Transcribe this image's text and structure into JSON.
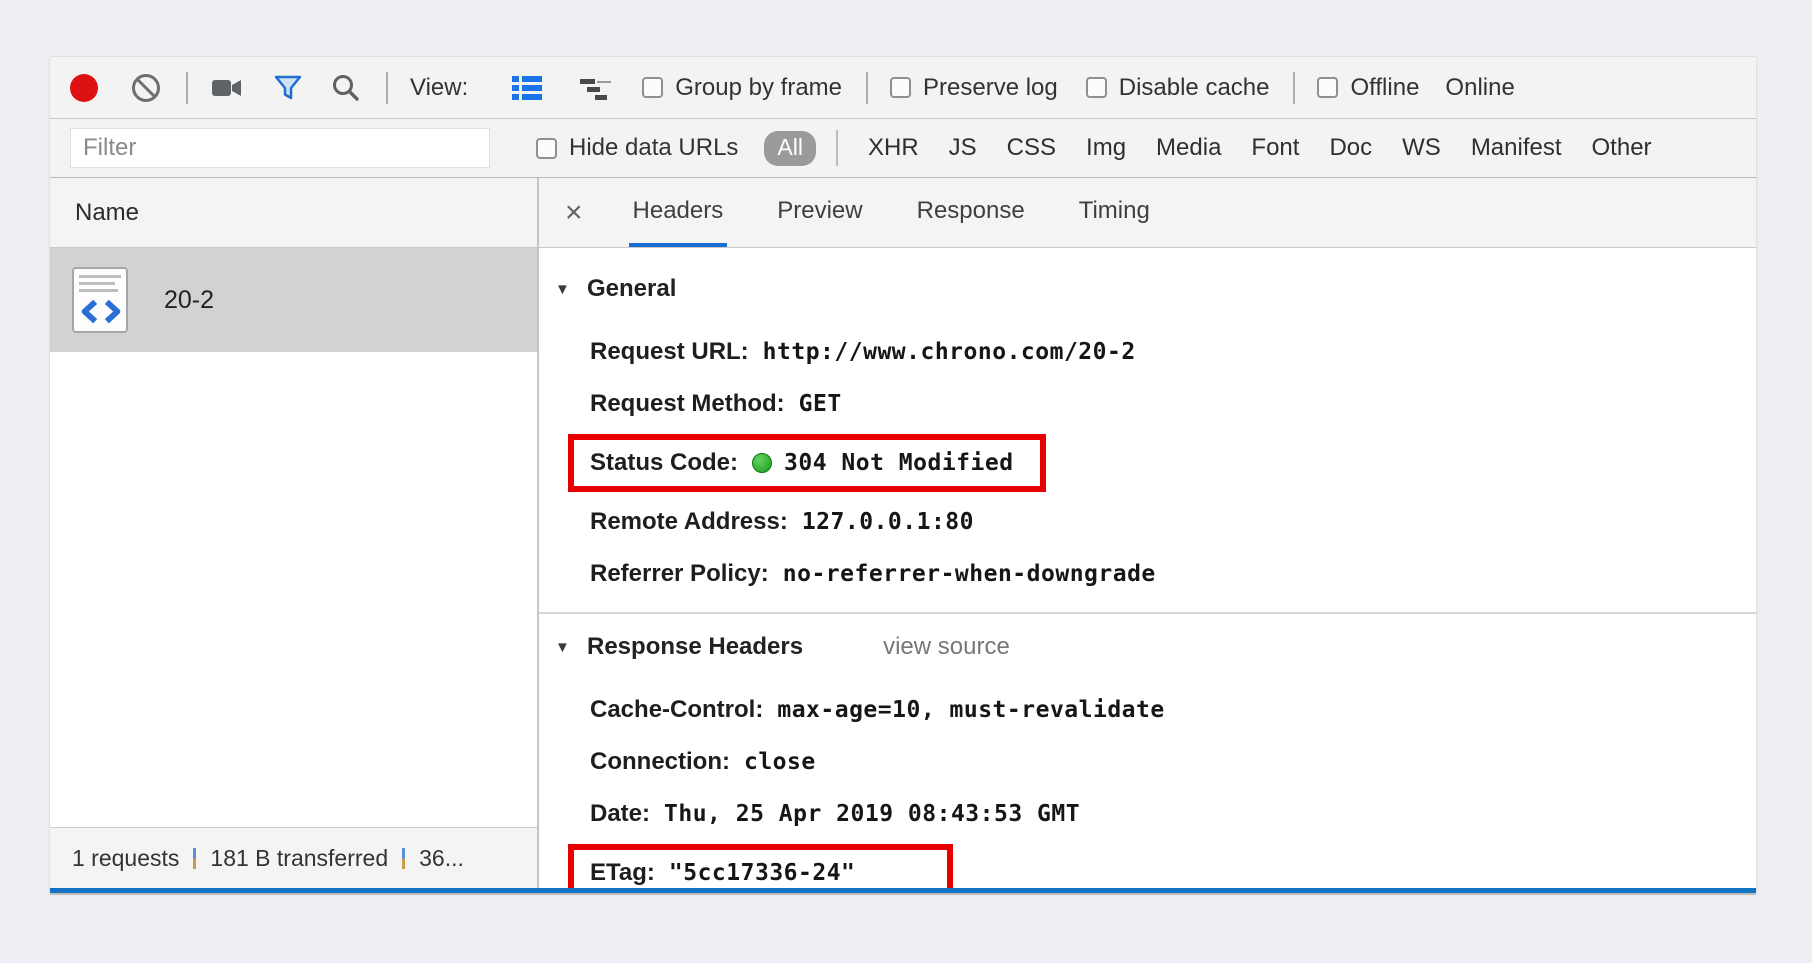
{
  "icons": {
    "collapse": "▼",
    "close": "×"
  },
  "toolbar": {
    "view_label": "View:",
    "group_by_frame": "Group by frame",
    "preserve_log": "Preserve log",
    "disable_cache": "Disable cache",
    "offline": "Offline",
    "online": "Online"
  },
  "filter_bar": {
    "placeholder": "Filter",
    "hide_data_urls": "Hide data URLs",
    "all_label": "All",
    "types": [
      "XHR",
      "JS",
      "CSS",
      "Img",
      "Media",
      "Font",
      "Doc",
      "WS",
      "Manifest",
      "Other"
    ]
  },
  "requests_panel": {
    "column_header": "Name",
    "rows": [
      {
        "name": "20-2",
        "selected": true
      }
    ],
    "summary": {
      "requests": "1 requests",
      "transferred": "181 B transferred",
      "more": "36..."
    }
  },
  "details_panel": {
    "tabs": [
      {
        "label": "Headers",
        "active": true
      },
      {
        "label": "Preview",
        "active": false
      },
      {
        "label": "Response",
        "active": false
      },
      {
        "label": "Timing",
        "active": false
      }
    ],
    "sections": [
      {
        "title": "General",
        "rows": [
          {
            "label": "Request URL:",
            "value": "http://www.chrono.com/20-2"
          },
          {
            "label": "Request Method:",
            "value": "GET"
          },
          {
            "label": "Status Code:",
            "value": "304 Not Modified",
            "status_dot": true,
            "highlighted": true
          },
          {
            "label": "Remote Address:",
            "value": "127.0.0.1:80"
          },
          {
            "label": "Referrer Policy:",
            "value": "no-referrer-when-downgrade"
          }
        ]
      },
      {
        "title": "Response Headers",
        "action": "view source",
        "rows": [
          {
            "label": "Cache-Control:",
            "value": "max-age=10, must-revalidate"
          },
          {
            "label": "Connection:",
            "value": "close"
          },
          {
            "label": "Date:",
            "value": "Thu, 25 Apr 2019 08:43:53 GMT"
          },
          {
            "label": "ETag:",
            "value": "\"5cc17336-24\"",
            "highlighted": true
          }
        ]
      }
    ]
  },
  "colors": {
    "accent_blue": "#1a6fd4",
    "record_red": "#dd1111",
    "annotation_red": "#e80000",
    "status_green": "#2aa52a",
    "selected_row": "#d2d2d2",
    "bottom_edge_blue": "#1273c4"
  }
}
